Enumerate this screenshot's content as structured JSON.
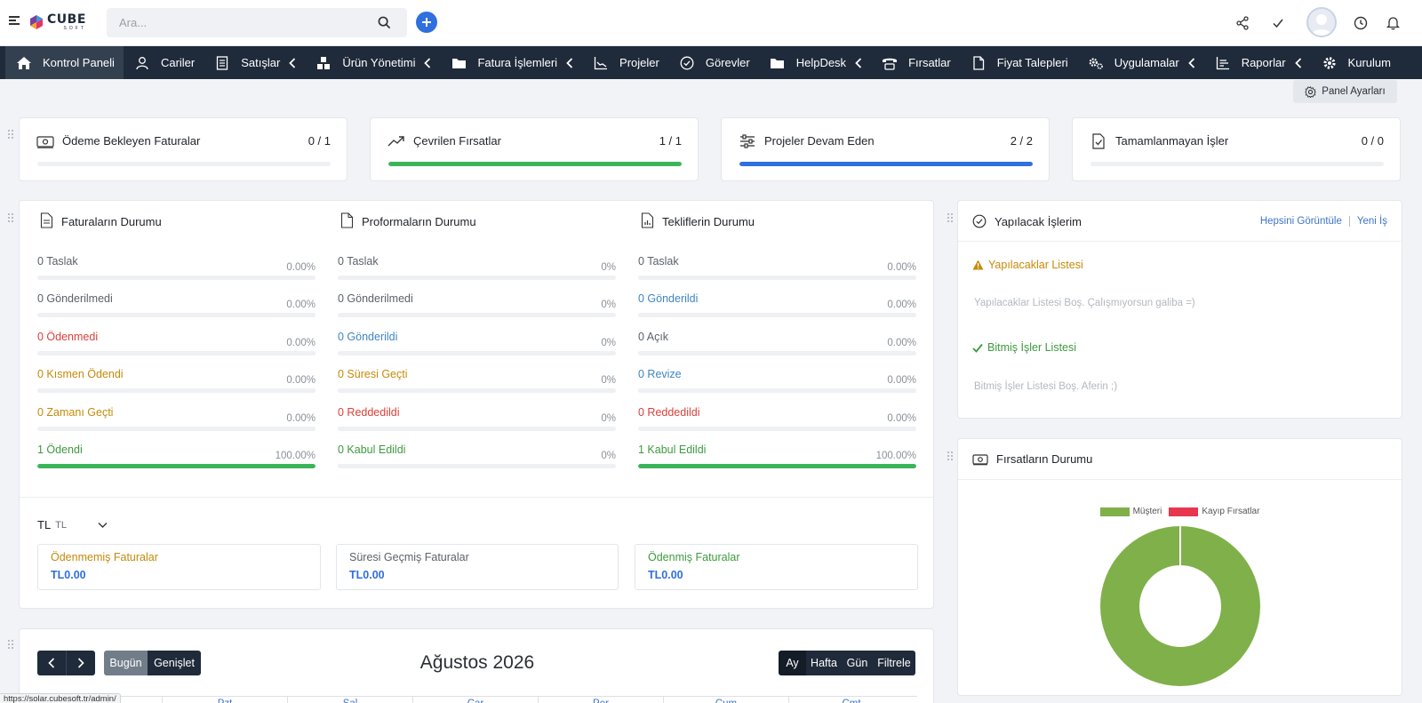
{
  "search": {
    "placeholder": "Ara..."
  },
  "nav": [
    {
      "label": "Kontrol Paneli",
      "icon": "home-icon",
      "active": true,
      "chevron": false
    },
    {
      "label": "Cariler",
      "icon": "user-icon",
      "chevron": false
    },
    {
      "label": "Satışlar",
      "icon": "receipt-icon",
      "chevron": true
    },
    {
      "label": "Ürün Yönetimi",
      "icon": "boxes-icon",
      "chevron": true
    },
    {
      "label": "Fatura İşlemleri",
      "icon": "folder-icon",
      "chevron": true
    },
    {
      "label": "Projeler",
      "icon": "chart-icon",
      "chevron": false
    },
    {
      "label": "Görevler",
      "icon": "check-circle-icon",
      "chevron": false
    },
    {
      "label": "HelpDesk",
      "icon": "folder-icon",
      "chevron": true
    },
    {
      "label": "Fırsatlar",
      "icon": "phone-icon",
      "chevron": false
    },
    {
      "label": "Fiyat Talepleri",
      "icon": "file-icon",
      "chevron": false
    },
    {
      "label": "Uygulamalar",
      "icon": "cogs-icon",
      "chevron": true
    },
    {
      "label": "Raporlar",
      "icon": "bar-chart-icon",
      "chevron": true
    },
    {
      "label": "Kurulum",
      "icon": "gear-icon",
      "chevron": false
    }
  ],
  "panel_settings": "Panel Ayarları",
  "stats": [
    {
      "title": "Ödeme Bekleyen Faturalar",
      "value": "0 / 1",
      "progress": 0,
      "color": "#3cb55a"
    },
    {
      "title": "Çevrilen Fırsatlar",
      "value": "1 / 1",
      "progress": 1,
      "color": "#3cb55a"
    },
    {
      "title": "Projeler Devam Eden",
      "value": "2 / 2",
      "progress": 1,
      "color": "#2f6fde"
    },
    {
      "title": "Tamamlanmayan İşler",
      "value": "0 / 0",
      "progress": 0,
      "color": "#3cb55a"
    }
  ],
  "status_sections": [
    {
      "title": "Faturaların Durumu",
      "rows": [
        {
          "label": "0 Taslak",
          "pct": "0.00%",
          "progress": 0,
          "tone": "gray"
        },
        {
          "label": "0 Gönderilmedi",
          "pct": "0.00%",
          "progress": 0,
          "tone": "gray"
        },
        {
          "label": "0 Ödenmedi",
          "pct": "0.00%",
          "progress": 0,
          "tone": "red"
        },
        {
          "label": "0 Kısmen Ödendi",
          "pct": "0.00%",
          "progress": 0,
          "tone": "orange"
        },
        {
          "label": "0 Zamanı Geçti",
          "pct": "0.00%",
          "progress": 0,
          "tone": "orange"
        },
        {
          "label": "1 Ödendi",
          "pct": "100.00%",
          "progress": 1,
          "tone": "green"
        }
      ]
    },
    {
      "title": "Proformaların Durumu",
      "rows": [
        {
          "label": "0 Taslak",
          "pct": "0%",
          "progress": 0,
          "tone": "gray"
        },
        {
          "label": "0 Gönderilmedi",
          "pct": "0%",
          "progress": 0,
          "tone": "gray"
        },
        {
          "label": "0 Gönderildi",
          "pct": "0%",
          "progress": 0,
          "tone": "blue"
        },
        {
          "label": "0 Süresi Geçti",
          "pct": "0%",
          "progress": 0,
          "tone": "orange"
        },
        {
          "label": "0 Reddedildi",
          "pct": "0%",
          "progress": 0,
          "tone": "red"
        },
        {
          "label": "0 Kabul Edildi",
          "pct": "0%",
          "progress": 0,
          "tone": "green"
        }
      ]
    },
    {
      "title": "Tekliflerin Durumu",
      "rows": [
        {
          "label": "0 Taslak",
          "pct": "0.00%",
          "progress": 0,
          "tone": "gray"
        },
        {
          "label": "0 Gönderildi",
          "pct": "0.00%",
          "progress": 0,
          "tone": "blue"
        },
        {
          "label": "0 Açık",
          "pct": "0.00%",
          "progress": 0,
          "tone": "gray"
        },
        {
          "label": "0 Revize",
          "pct": "0.00%",
          "progress": 0,
          "tone": "blue"
        },
        {
          "label": "0 Reddedildi",
          "pct": "0.00%",
          "progress": 0,
          "tone": "red"
        },
        {
          "label": "1 Kabul Edildi",
          "pct": "100.00%",
          "progress": 1,
          "tone": "green"
        }
      ]
    }
  ],
  "currency": {
    "code": "TL",
    "sub": "TL"
  },
  "summary": [
    {
      "title": "Ödenmemiş Faturalar",
      "amount": "TL0.00",
      "tone": "orange"
    },
    {
      "title": "Süresi Geçmiş Faturalar",
      "amount": "TL0.00",
      "tone": "gray"
    },
    {
      "title": "Ödenmiş Faturalar",
      "amount": "TL0.00",
      "tone": "green"
    }
  ],
  "todo": {
    "title": "Yapılacak İşlerim",
    "view_all": "Hepsini Görüntüle",
    "new": "Yeni İş",
    "todo_list_title": "Yapılacaklar Listesi",
    "todo_empty": "Yapılacaklar Listesi Boş. Çalışmıyorsun galiba =)",
    "done_list_title": "Bitmiş İşler Listesi",
    "done_empty": "Bitmiş İşler Listesi Boş. Aferin ;)"
  },
  "opportunities": {
    "title": "Fırsatların Durumu"
  },
  "chart_data": {
    "type": "pie",
    "labels": [
      "Müşteri",
      "Kayıp Fırsatlar"
    ],
    "values": [
      1,
      0
    ],
    "colors": [
      "#80b04a",
      "#e8364f"
    ],
    "legend": "top"
  },
  "calendar": {
    "title": "Ağustos 2026",
    "today": "Bugün",
    "expand": "Genişlet",
    "views": [
      "Ay",
      "Hafta",
      "Gün",
      "Filtrele"
    ],
    "days": [
      "Pzt",
      "Sal",
      "Çar",
      "Per",
      "Cum",
      "Cmt"
    ]
  },
  "status_url": "https://solar.cubesoft.tr/admin/"
}
